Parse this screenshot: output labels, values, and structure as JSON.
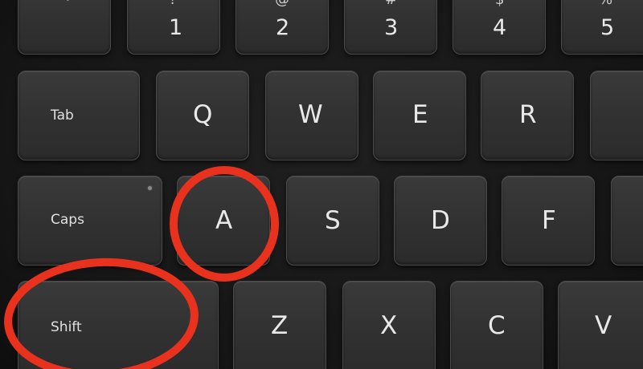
{
  "keyboard": {
    "row_number": [
      {
        "name": "key-backtick",
        "main": "`",
        "shift": ""
      },
      {
        "name": "key-1",
        "main": "1",
        "shift": "!"
      },
      {
        "name": "key-2",
        "main": "2",
        "shift": "@"
      },
      {
        "name": "key-3",
        "main": "3",
        "shift": "#"
      },
      {
        "name": "key-4",
        "main": "4",
        "shift": "$"
      },
      {
        "name": "key-5",
        "main": "5",
        "shift": "%"
      }
    ],
    "row_top": [
      {
        "name": "key-tab",
        "label": "Tab"
      },
      {
        "name": "key-q",
        "label": "Q"
      },
      {
        "name": "key-w",
        "label": "W"
      },
      {
        "name": "key-e",
        "label": "E"
      },
      {
        "name": "key-r",
        "label": "R"
      }
    ],
    "row_home": [
      {
        "name": "key-caps",
        "label": "Caps"
      },
      {
        "name": "key-a",
        "label": "A"
      },
      {
        "name": "key-s",
        "label": "S"
      },
      {
        "name": "key-d",
        "label": "D"
      },
      {
        "name": "key-f",
        "label": "F"
      }
    ],
    "row_bottom": [
      {
        "name": "key-shift",
        "label": "Shift"
      },
      {
        "name": "key-z",
        "label": "Z"
      },
      {
        "name": "key-x",
        "label": "X"
      },
      {
        "name": "key-c",
        "label": "C"
      },
      {
        "name": "key-v",
        "label": "V"
      }
    ]
  },
  "annotations": {
    "color": "#e8321e",
    "highlighted_keys": [
      "A",
      "Shift"
    ]
  },
  "colors": {
    "key_face": "#333333",
    "key_label": "#e9e9e9",
    "background": "#141414"
  }
}
